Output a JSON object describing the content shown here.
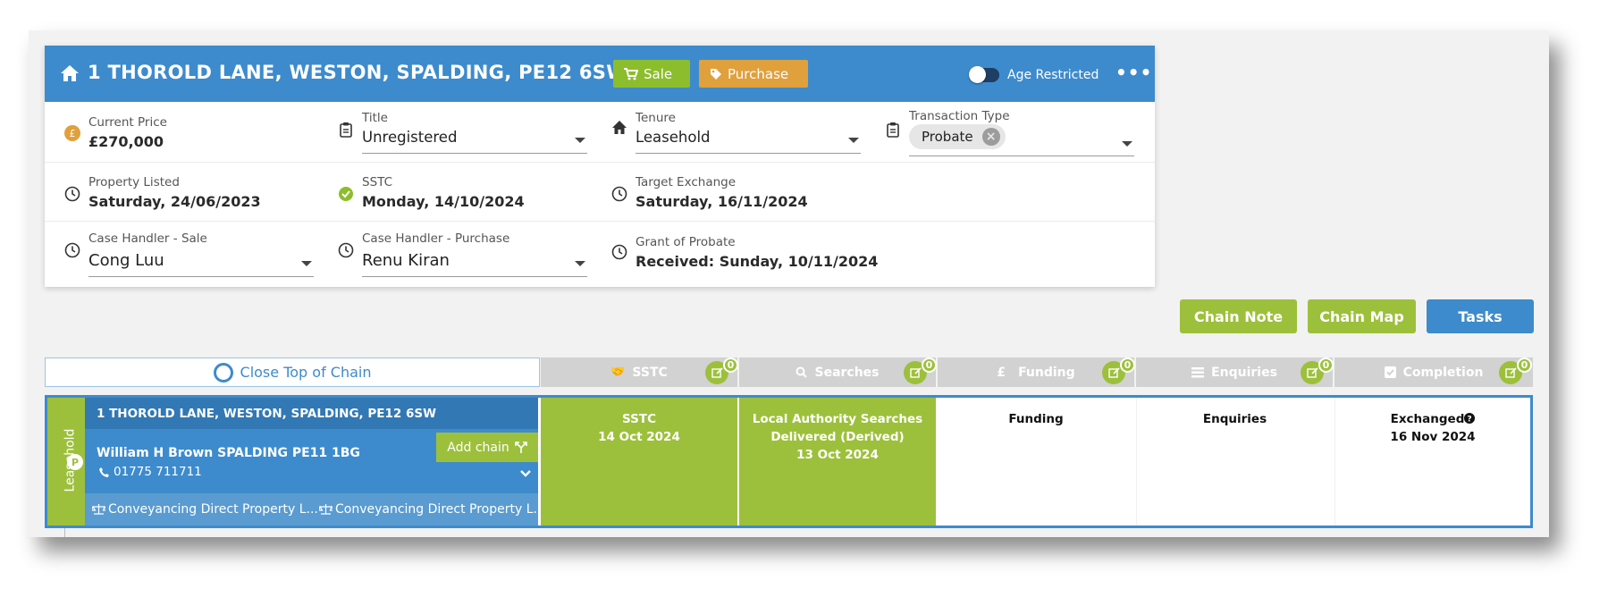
{
  "header": {
    "address": "1 THOROLD LANE, WESTON, SPALDING, PE12 6SW",
    "sale_label": "Sale",
    "purchase_label": "Purchase",
    "age_restricted_label": "Age Restricted",
    "colors": {
      "header": "#3d8bcc",
      "sale": "#8cbd2c",
      "purchase": "#e0a03c"
    }
  },
  "fields": {
    "current_price": {
      "label": "Current Price",
      "value": "£270,000"
    },
    "title": {
      "label": "Title",
      "value": "Unregistered"
    },
    "tenure": {
      "label": "Tenure",
      "value": "Leasehold"
    },
    "transaction_type": {
      "label": "Transaction Type",
      "value": "Probate"
    },
    "property_listed": {
      "label": "Property Listed",
      "value": "Saturday, 24/06/2023"
    },
    "sstc": {
      "label": "SSTC",
      "value": "Monday, 14/10/2024"
    },
    "target_exchange": {
      "label": "Target Exchange",
      "value": "Saturday, 16/11/2024"
    },
    "case_handler_sale": {
      "label": "Case Handler - Sale",
      "value": "Cong Luu"
    },
    "case_handler_purchase": {
      "label": "Case Handler - Purchase",
      "value": "Renu Kiran"
    },
    "grant_of_probate": {
      "label": "Grant of Probate",
      "value": "Received: Sunday, 10/11/2024"
    }
  },
  "actions": {
    "chain_note": "Chain Note",
    "chain_map": "Chain Map",
    "tasks": "Tasks"
  },
  "chain_tabs": {
    "top_of_chain": "Close Top of Chain",
    "tabs": [
      {
        "label": "SSTC",
        "count": "0"
      },
      {
        "label": "Searches",
        "count": "0"
      },
      {
        "label": "Funding",
        "count": "0"
      },
      {
        "label": "Enquiries",
        "count": "0"
      },
      {
        "label": "Completion",
        "count": "0"
      }
    ]
  },
  "chain_row": {
    "tenure_label": "Leasehold",
    "badge": "P",
    "address": "1 THOROLD LANE, WESTON, SPALDING, PE12 6SW",
    "agent": "William H Brown SPALDING PE11 1BG",
    "phone": "01775 711711",
    "add_chain": "Add chain",
    "solicitor_sale": "Conveyancing Direct Property L...",
    "solicitor_purchase": "Conveyancing Direct Property L...",
    "stages": {
      "sstc": {
        "title": "SSTC",
        "date": "14 Oct 2024"
      },
      "searches": {
        "title": "Local Authority Searches",
        "status": "Delivered (Derived)",
        "date": "13 Oct 2024"
      },
      "funding": {
        "title": "Funding"
      },
      "enquiries": {
        "title": "Enquiries"
      },
      "completion": {
        "title": "Exchanged",
        "date": "16 Nov 2024"
      }
    }
  }
}
